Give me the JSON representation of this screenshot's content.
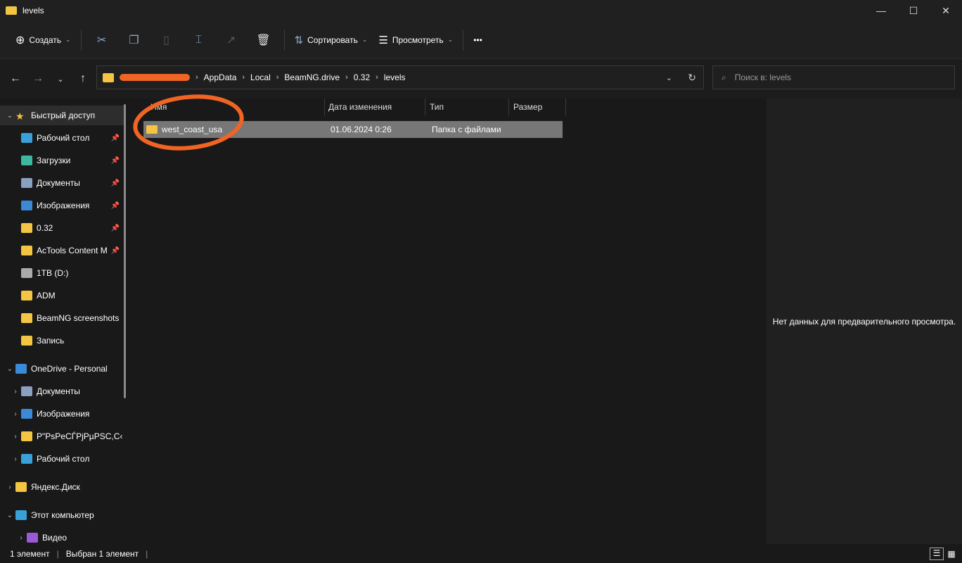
{
  "window": {
    "title": "levels",
    "minimize": "—",
    "maximize": "☐",
    "close": "✕"
  },
  "toolbar": {
    "create": "Создать",
    "sort": "Сортировать",
    "view": "Просмотреть",
    "more": "•••"
  },
  "address": {
    "crumbs": [
      "AppData",
      "Local",
      "BeamNG.drive",
      "0.32",
      "levels"
    ],
    "search_placeholder": "Поиск в: levels"
  },
  "sidebar": {
    "items": [
      {
        "label": "Быстрый доступ",
        "level": 0,
        "expanded": true
      },
      {
        "label": "Рабочий стол",
        "pinned": true
      },
      {
        "label": "Загрузки",
        "pinned": true
      },
      {
        "label": "Документы",
        "pinned": true
      },
      {
        "label": "Изображения",
        "pinned": true
      },
      {
        "label": "0.32",
        "pinned": true
      },
      {
        "label": "AcTools Content M",
        "pinned": true
      },
      {
        "label": "1TB (D:)"
      },
      {
        "label": "ADM"
      },
      {
        "label": "BeamNG screenshots"
      },
      {
        "label": "Запись"
      },
      {
        "label": "OneDrive - Personal",
        "level": 0,
        "expanded": true
      },
      {
        "label": "Документы"
      },
      {
        "label": "Изображения"
      },
      {
        "label": "P\"PsPeCЃPjPµPSC,C‹"
      },
      {
        "label": "Рабочий стол"
      },
      {
        "label": "Яндекс.Диск",
        "level": 0
      },
      {
        "label": "Этот компьютер",
        "level": 0,
        "expanded": true
      },
      {
        "label": "Видео"
      }
    ]
  },
  "columns": {
    "name": "Имя",
    "date": "Дата изменения",
    "type": "Тип",
    "size": "Размер"
  },
  "files": [
    {
      "name": "west_coast_usa",
      "date": "01.06.2024 0:26",
      "type": "Папка с файлами",
      "size": ""
    }
  ],
  "preview": {
    "text": "Нет данных для предварительного просмотра."
  },
  "status": {
    "count": "1 элемент",
    "selected": "Выбран 1 элемент"
  }
}
